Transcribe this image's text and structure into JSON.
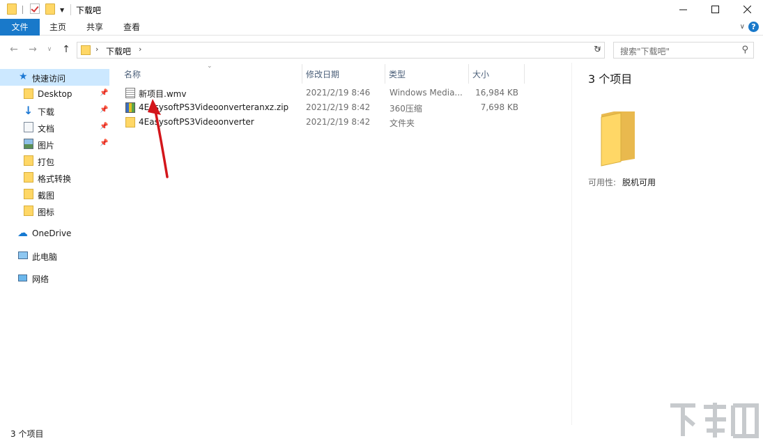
{
  "window": {
    "title": "下载吧"
  },
  "ribbon": {
    "tabs": [
      {
        "label": "文件",
        "active": true
      },
      {
        "label": "主页"
      },
      {
        "label": "共享"
      },
      {
        "label": "查看"
      }
    ],
    "help": "?"
  },
  "address": {
    "crumb": "下载吧",
    "search_placeholder": "搜索\"下载吧\""
  },
  "sidebar": {
    "items": [
      {
        "label": "快速访问",
        "icon": "star-icon",
        "selected": true
      },
      {
        "label": "Desktop",
        "icon": "folder-icon",
        "pinned": true
      },
      {
        "label": "下载",
        "icon": "download-icon",
        "pinned": true
      },
      {
        "label": "文档",
        "icon": "document-icon",
        "pinned": true
      },
      {
        "label": "图片",
        "icon": "pictures-icon",
        "pinned": true
      },
      {
        "label": "打包",
        "icon": "folder-icon"
      },
      {
        "label": "格式转换",
        "icon": "folder-icon"
      },
      {
        "label": "截图",
        "icon": "folder-icon"
      },
      {
        "label": "图标",
        "icon": "folder-icon"
      },
      {
        "label": "OneDrive",
        "icon": "cloud-icon"
      },
      {
        "label": "此电脑",
        "icon": "computer-icon"
      },
      {
        "label": "网络",
        "icon": "network-icon"
      }
    ]
  },
  "columns": {
    "name": "名称",
    "date": "修改日期",
    "type": "类型",
    "size": "大小"
  },
  "files": [
    {
      "name": "新项目.wmv",
      "date": "2021/2/19 8:46",
      "type": "Windows Media...",
      "size": "16,984 KB",
      "icon": "wmv-file-icon"
    },
    {
      "name": "4EasysoftPS3Videoonverteranxz.zip",
      "date": "2021/2/19 8:42",
      "type": "360压缩",
      "size": "7,698 KB",
      "icon": "zip-file-icon"
    },
    {
      "name": "4EasysoftPS3Videoonverter",
      "date": "2021/2/19 8:42",
      "type": "文件夹",
      "size": "",
      "icon": "folder-icon"
    }
  ],
  "details": {
    "count": "3 个项目",
    "availability_label": "可用性:",
    "availability_value": "脱机可用"
  },
  "status": {
    "text": "3 个项目"
  },
  "colors": {
    "accent": "#1979ca",
    "selection": "#cce8ff",
    "folder": "#ffd766",
    "annotation_arrow": "#d3161b"
  }
}
